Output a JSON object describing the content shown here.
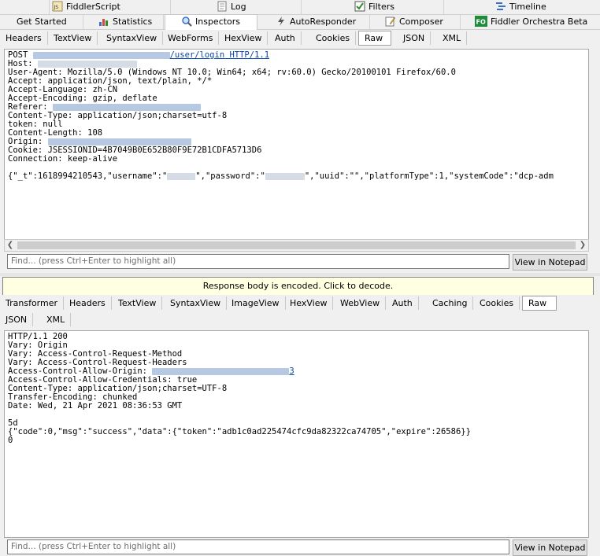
{
  "top_tabs_row1": {
    "fiddlerscript": "FiddlerScript",
    "log": "Log",
    "filters": "Filters",
    "timeline": "Timeline"
  },
  "top_tabs_row2": {
    "get_started": "Get Started",
    "statistics": "Statistics",
    "inspectors": "Inspectors",
    "autoresponder": "AutoResponder",
    "composer": "Composer",
    "orchestra": "Fiddler Orchestra Beta"
  },
  "request_tabs": [
    "Headers",
    "TextView",
    "SyntaxView",
    "WebForms",
    "HexView",
    "Auth",
    "Cookies",
    "Raw",
    "JSON",
    "XML"
  ],
  "request": {
    "line1_method": "POST ",
    "line1_path": "/user/login HTTP/1.1",
    "host_label": "Host: ",
    "user_agent": "User-Agent: Mozilla/5.0 (Windows NT 10.0; Win64; x64; rv:60.0) Gecko/20100101 Firefox/60.0",
    "accept": "Accept: application/json, text/plain, */*",
    "accept_language": "Accept-Language: zh-CN",
    "accept_encoding": "Accept-Encoding: gzip, deflate",
    "referer_label": "Referer: ",
    "content_type": "Content-Type: application/json;charset=utf-8",
    "token": "token: null",
    "content_length": "Content-Length: 108",
    "origin_label": "Origin: ",
    "cookie": "Cookie: JSESSIONID=4B7049B0E652B80F9E72B1CDFA5713D6",
    "connection": "Connection: keep-alive",
    "body_part1": "{\"_t\":1618994210543,\"username\":\"",
    "body_part2": "\",\"password\":\"",
    "body_part3": "\",\"uuid\":\"\",\"platformType\":1,\"systemCode\":\"dcp-adm"
  },
  "find_placeholder": "Find... (press Ctrl+Enter to highlight all)",
  "view_in_notepad": "View in Notepad",
  "response_banner": "Response body is encoded. Click to decode.",
  "response_tabs_row1": [
    "Transformer",
    "Headers",
    "TextView",
    "SyntaxView",
    "ImageView",
    "HexView",
    "WebView",
    "Auth",
    "Caching",
    "Cookies",
    "Raw"
  ],
  "response_tabs_row2": [
    "JSON",
    "XML"
  ],
  "response": {
    "status": "HTTP/1.1 200",
    "vary1": "Vary: Origin",
    "vary2": "Vary: Access-Control-Request-Method",
    "vary3": "Vary: Access-Control-Request-Headers",
    "acao_label": "Access-Control-Allow-Origin: ",
    "acao_tail": "3",
    "acac": "Access-Control-Allow-Credentials: true",
    "content_type": "Content-Type: application/json;charset=UTF-8",
    "transfer_encoding": "Transfer-Encoding: chunked",
    "date": "Date: Wed, 21 Apr 2021 08:36:53 GMT",
    "chunk_size": "5d",
    "body": "{\"code\":0,\"msg\":\"success\",\"data\":{\"token\":\"adb1c0ad225474cfc9da82322ca74705\",\"expire\":26586}}",
    "chunk_end": "0"
  },
  "colors": {
    "link": "#0645ad",
    "banner_bg": "#ffffe1",
    "filters_check": "#2e8b2e",
    "orchestra_badge": "#1e8c3a"
  }
}
